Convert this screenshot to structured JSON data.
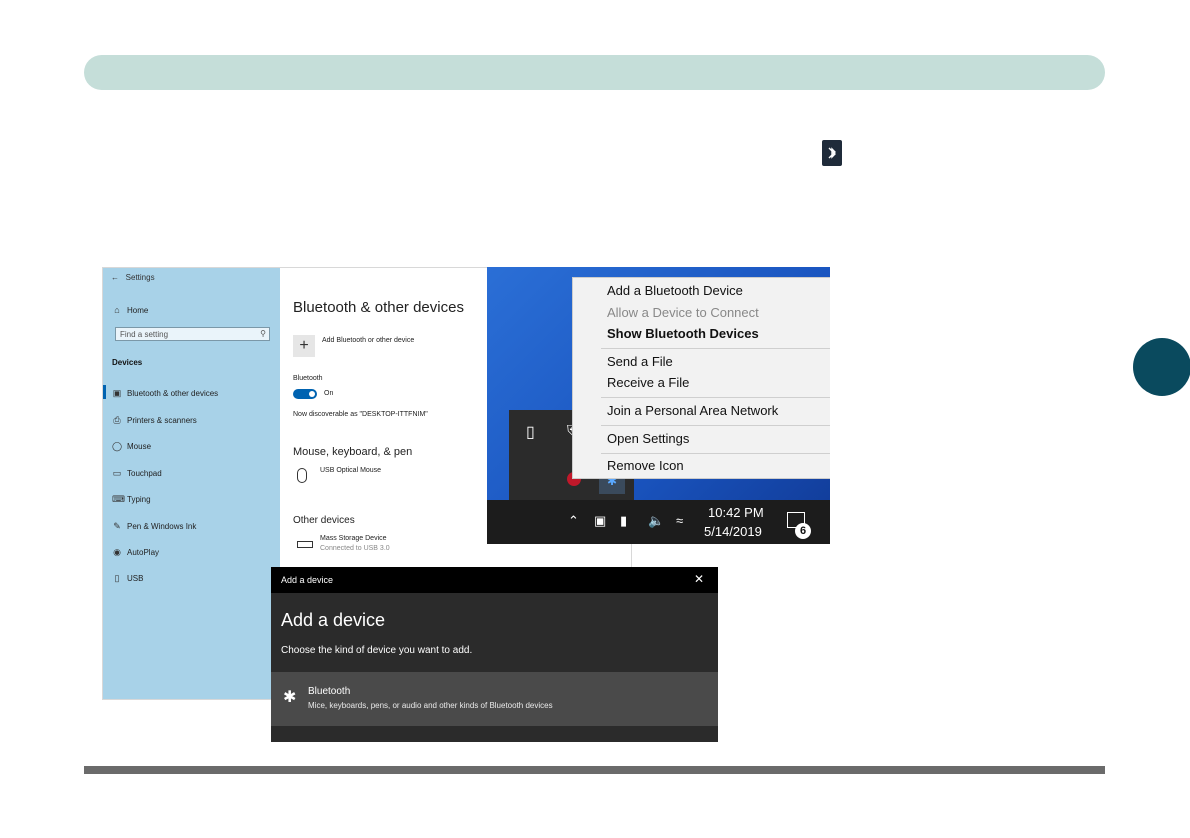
{
  "page": {
    "header_color": "#c5ded9",
    "tab_color": "#0a4a5e",
    "footer_color": "#6b6b6b",
    "inline_icon": "bluetooth-icon"
  },
  "settings": {
    "window_title": "Settings",
    "back_icon": "back-arrow-icon",
    "sidebar": {
      "home": "Home",
      "search_placeholder": "Find a setting",
      "category": "Devices",
      "items": [
        {
          "label": "Bluetooth & other devices",
          "icon": "bluetooth-devices-icon"
        },
        {
          "label": "Printers & scanners",
          "icon": "printer-icon"
        },
        {
          "label": "Mouse",
          "icon": "mouse-icon"
        },
        {
          "label": "Touchpad",
          "icon": "touchpad-icon"
        },
        {
          "label": "Typing",
          "icon": "keyboard-icon"
        },
        {
          "label": "Pen & Windows Ink",
          "icon": "pen-icon"
        },
        {
          "label": "AutoPlay",
          "icon": "autoplay-icon"
        },
        {
          "label": "USB",
          "icon": "usb-icon"
        }
      ]
    },
    "main": {
      "title": "Bluetooth & other devices",
      "add_label": "Add Bluetooth or other device",
      "bluetooth_label": "Bluetooth",
      "toggle_state": "On",
      "discoverable": "Now discoverable as \"DESKTOP-ITTFNIM\"",
      "mouse_section": "Mouse, keyboard, & pen",
      "mouse_device": "USB Optical Mouse",
      "other_section": "Other devices",
      "storage_device": "Mass Storage Device",
      "storage_status": "Connected to USB 3.0"
    }
  },
  "context_menu": {
    "items": [
      {
        "label": "Add a Bluetooth Device",
        "state": "normal"
      },
      {
        "label": "Allow a Device to Connect",
        "state": "disabled"
      },
      {
        "label": "Show Bluetooth Devices",
        "state": "bold"
      },
      {
        "label": "Send a File",
        "state": "normal"
      },
      {
        "label": "Receive a File",
        "state": "normal"
      },
      {
        "label": "Join a Personal Area Network",
        "state": "normal"
      },
      {
        "label": "Open Settings",
        "state": "normal"
      },
      {
        "label": "Remove Icon",
        "state": "normal"
      }
    ]
  },
  "taskbar": {
    "time": "10:42 PM",
    "date": "5/14/2019",
    "notification_count": "6"
  },
  "add_device": {
    "bar_title": "Add a device",
    "title": "Add a device",
    "subtitle": "Choose the kind of device you want to add.",
    "option_title": "Bluetooth",
    "option_desc": "Mice, keyboards, pens, or audio and other kinds of Bluetooth devices"
  }
}
